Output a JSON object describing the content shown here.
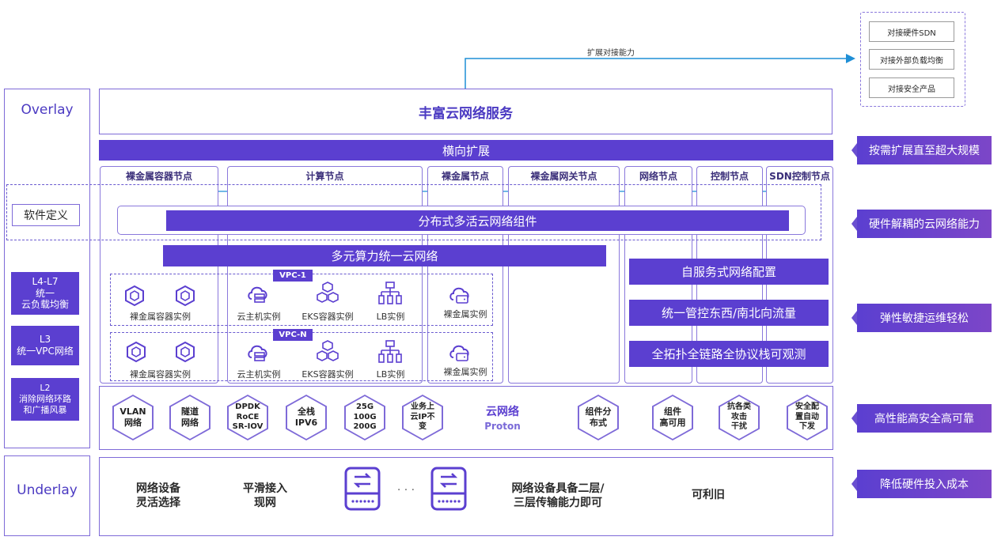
{
  "extend": {
    "label": "扩展对接能力",
    "items": [
      "对接硬件SDN",
      "对接外部负载均衡",
      "对接安全产品"
    ]
  },
  "left": {
    "overlay": "Overlay",
    "software_defined": "软件定义",
    "l4l7": "L4-L7\n统一\n云负载均衡",
    "l3": "L3\n统一VPC网络",
    "l2": "L2\n消除网络环路\n和广播风暴",
    "underlay": "Underlay"
  },
  "main": {
    "service_title": "丰富云网络服务",
    "horizontal": "横向扩展",
    "nodes": [
      "裸金属容器节点",
      "计算节点",
      "裸金属节点",
      "裸金属网关节点",
      "网络节点",
      "控制节点",
      "SDN控制节点"
    ],
    "distributed": "分布式多活云网络组件",
    "multi_compute": "多元算力统一云网络",
    "vpc1": "VPC-1",
    "vpcn": "VPC-N",
    "inst_bm_container": "裸金属容器实例",
    "inst_cloud_host": "云主机实例",
    "inst_eks": "EKS容器实例",
    "inst_lb": "LB实例",
    "inst_bm": "裸金属实例",
    "features": [
      "自服务式网络配置",
      "统一管控东西/南北向流量",
      "全拓扑全链路全协议栈可观测"
    ]
  },
  "proton": {
    "title": "云网络",
    "subtitle": "Proton",
    "left_hexes": [
      "VLAN\n网络",
      "隧道\n网络",
      "DPDK\nRoCE\nSR-IOV",
      "全栈\nIPV6",
      "25G\n100G\n200G",
      "业务上\n云IP不\n变"
    ],
    "right_hexes": [
      "组件分\n布式",
      "组件\n高可用",
      "抗各类\n攻击\n干扰",
      "安全配\n置自动\n下发"
    ]
  },
  "underlay": {
    "items": [
      "网络设备\n灵活选择",
      "平滑接入\n现网",
      "网络设备具备二层/\n三层传输能力即可",
      "可利旧"
    ],
    "dots": "· · ·"
  },
  "right_labels": [
    "按需扩展直至超大规模",
    "硬件解耦的云网络能力",
    "弹性敏捷运维轻松",
    "高性能高安全高可靠",
    "降低硬件投入成本"
  ],
  "colors": {
    "primary": "#5b3fd0",
    "border": "#7e6ad8",
    "accent": "#1f8fd6"
  }
}
